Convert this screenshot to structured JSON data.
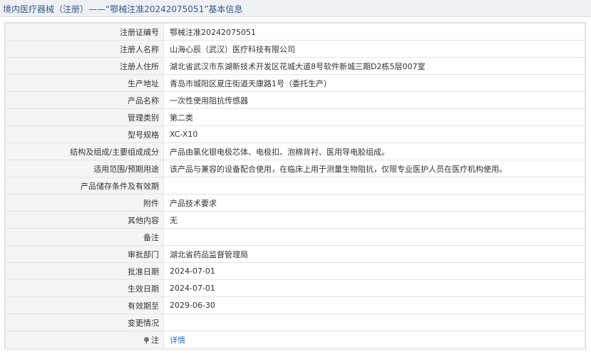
{
  "header": {
    "title": "境内医疗器械（注册）——“鄂械注准20242075051”基本信息"
  },
  "fields": [
    {
      "label": "注册证编号",
      "value": "鄂械注准20242075051"
    },
    {
      "label": "注册人名称",
      "value": "山海心辰（武汉）医疗科技有限公司"
    },
    {
      "label": "注册人住所",
      "value": "湖北省武汉市东湖新技术开发区花城大道8号软件新城三期D2栋5层007室"
    },
    {
      "label": "生产地址",
      "value": "青岛市城阳区夏庄街道天康路1号（委托生产）"
    },
    {
      "label": "产品名称",
      "value": "一次性使用阻抗传感器"
    },
    {
      "label": "管理类别",
      "value": "第二类"
    },
    {
      "label": "型号规格",
      "value": "XC-X10"
    },
    {
      "label": "结构及组成/主要组成成分",
      "value": "产品由氯化银电极芯体、电极扣、泡棉背衬、医用导电胶组成。"
    },
    {
      "label": "适用范围/预期用途",
      "value": "该产品与兼容的设备配合使用，在临床上用于测量生物阻抗，仅限专业医护人员在医疗机构使用。"
    },
    {
      "label": "产品储存条件及有效期",
      "value": ""
    },
    {
      "label": "附件",
      "value": "产品技术要求"
    },
    {
      "label": "其他内容",
      "value": "无"
    },
    {
      "label": "备注",
      "value": ""
    },
    {
      "label": "审批部门",
      "value": "湖北省药品监督管理局"
    },
    {
      "label": "批准日期",
      "value": "2024-07-01"
    },
    {
      "label": "生效日期",
      "value": "2024-07-01"
    },
    {
      "label": "有效期至",
      "value": "2029-06-30"
    },
    {
      "label": "变更情况",
      "value": ""
    }
  ],
  "note": {
    "icon": "pin-icon",
    "label": "注",
    "link_text": "详情"
  },
  "colors": {
    "header_bg": "#eef0f4",
    "title_text": "#3a5a8c",
    "label_bg": "#f5f5f5",
    "link": "#2b6cc4",
    "border": "#e3e5e8"
  }
}
